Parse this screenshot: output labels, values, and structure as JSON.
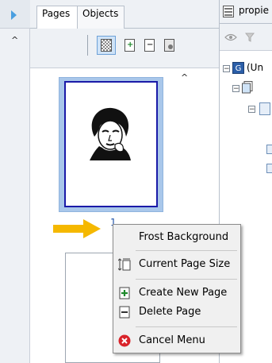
{
  "panel": {
    "tabs": [
      {
        "label": "Pages"
      },
      {
        "label": "Objects"
      }
    ],
    "active_tab": "Pages",
    "toolbar_icons": [
      "frost-background-icon",
      "create-page-icon",
      "delete-page-icon",
      "page-size-icon"
    ],
    "page_number": "1"
  },
  "right_panel": {
    "title": "propie",
    "tree_root": "(Un"
  },
  "context_menu": {
    "items": [
      {
        "label": "Frost Background",
        "icon": ""
      },
      {
        "label": "Current Page Size",
        "icon": "page-size-icon"
      },
      {
        "label": "Create New Page",
        "icon": "create-page-icon"
      },
      {
        "label": "Delete Page",
        "icon": "delete-page-icon"
      },
      {
        "label": "Cancel Menu",
        "icon": "cancel-icon"
      }
    ]
  },
  "colors": {
    "accent_blue": "#1a1aa8",
    "thumb_border": "#a9c7ea",
    "arrow": "#f5b800",
    "cancel_red": "#d9232a",
    "plus_green": "#1f8a2c"
  }
}
